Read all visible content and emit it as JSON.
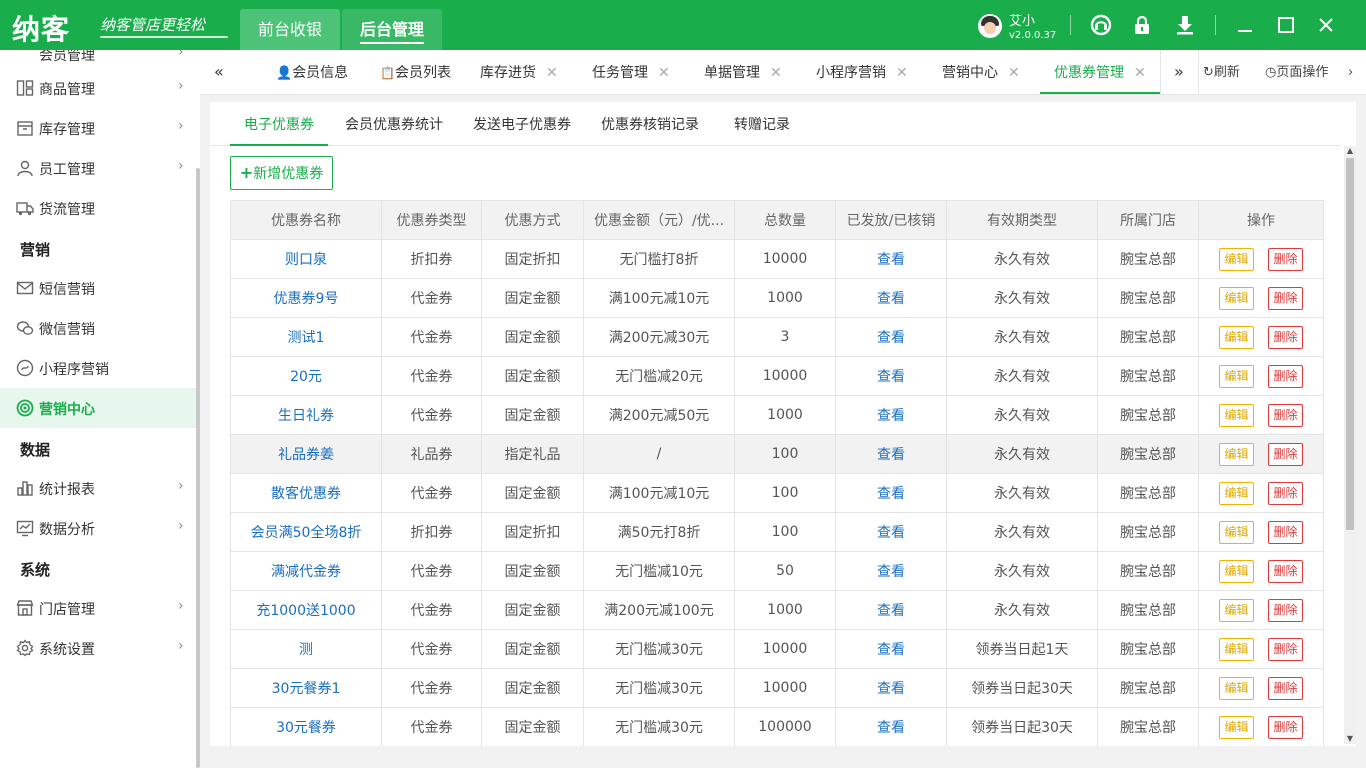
{
  "header": {
    "logo": "纳客",
    "slogan": "纳客管店更轻松",
    "nav": [
      "前台收银",
      "后台管理"
    ],
    "active_nav": 1,
    "user_name": "艾小",
    "version": "v2.0.0.37",
    "icons": [
      "headset-icon",
      "lock-icon",
      "download-icon",
      "minimize-icon",
      "maximize-icon",
      "close-icon"
    ]
  },
  "sidebar": {
    "partial_item": "会员管理",
    "items": [
      {
        "label": "商品管理",
        "icon": "product-icon",
        "arrow": true
      },
      {
        "label": "库存管理",
        "icon": "inventory-icon",
        "arrow": true
      },
      {
        "label": "员工管理",
        "icon": "staff-icon",
        "arrow": true
      },
      {
        "label": "货流管理",
        "icon": "truck-icon",
        "arrow": false
      }
    ],
    "group_marketing": "营销",
    "marketing_items": [
      {
        "label": "短信营销",
        "icon": "sms-icon"
      },
      {
        "label": "微信营销",
        "icon": "wechat-icon"
      },
      {
        "label": "小程序营销",
        "icon": "mini-program-icon"
      },
      {
        "label": "营销中心",
        "icon": "target-icon"
      }
    ],
    "group_data": "数据",
    "data_items": [
      {
        "label": "统计报表",
        "icon": "bar-chart-icon"
      },
      {
        "label": "数据分析",
        "icon": "analytics-icon"
      }
    ],
    "group_system": "系统",
    "system_items": [
      {
        "label": "门店管理",
        "icon": "store-icon"
      },
      {
        "label": "系统设置",
        "icon": "gear-icon"
      }
    ]
  },
  "tabs": {
    "items": [
      "会员信息",
      "会员列表",
      "库存进货",
      "任务管理",
      "单据管理",
      "小程序营销",
      "营销中心",
      "优惠券管理"
    ],
    "active": 7,
    "refresh": "刷新",
    "page_ops": "页面操作"
  },
  "subtabs": [
    "电子优惠券",
    "会员优惠券统计",
    "发送电子优惠券",
    "优惠券核销记录",
    "转赠记录"
  ],
  "add_button": "新增优惠券",
  "table": {
    "headers": [
      "优惠券名称",
      "优惠券类型",
      "优惠方式",
      "优惠金额（元）/优...",
      "总数量",
      "已发放/已核销",
      "有效期类型",
      "所属门店",
      "操作"
    ],
    "view_label": "查看",
    "edit_label": "编辑",
    "delete_label": "删除",
    "rows": [
      [
        "则口泉",
        "折扣券",
        "固定折扣",
        "无门槛打8折",
        "10000",
        "永久有效",
        "腕宝总部"
      ],
      [
        "优惠券9号",
        "代金券",
        "固定金额",
        "满100元减10元",
        "1000",
        "永久有效",
        "腕宝总部"
      ],
      [
        "测试1",
        "代金券",
        "固定金额",
        "满200元减30元",
        "3",
        "永久有效",
        "腕宝总部"
      ],
      [
        "20元",
        "代金券",
        "固定金额",
        "无门槛减20元",
        "10000",
        "永久有效",
        "腕宝总部"
      ],
      [
        "生日礼券",
        "代金券",
        "固定金额",
        "满200元减50元",
        "1000",
        "永久有效",
        "腕宝总部"
      ],
      [
        "礼品券姜",
        "礼品券",
        "指定礼品",
        "/",
        "100",
        "永久有效",
        "腕宝总部"
      ],
      [
        "散客优惠券",
        "代金券",
        "固定金额",
        "满100元减10元",
        "100",
        "永久有效",
        "腕宝总部"
      ],
      [
        "会员满50全场8折",
        "折扣券",
        "固定折扣",
        "满50元打8折",
        "100",
        "永久有效",
        "腕宝总部"
      ],
      [
        "满减代金券",
        "代金券",
        "固定金额",
        "无门槛减10元",
        "50",
        "永久有效",
        "腕宝总部"
      ],
      [
        "充1000送1000",
        "代金券",
        "固定金额",
        "满200元减100元",
        "1000",
        "永久有效",
        "腕宝总部"
      ],
      [
        "测",
        "代金券",
        "固定金额",
        "无门槛减30元",
        "10000",
        "领券当日起1天",
        "腕宝总部"
      ],
      [
        "30元餐券1",
        "代金券",
        "固定金额",
        "无门槛减30元",
        "10000",
        "领券当日起30天",
        "腕宝总部"
      ],
      [
        "30元餐券",
        "代金券",
        "固定金额",
        "无门槛减30元",
        "100000",
        "领券当日起30天",
        "腕宝总部"
      ]
    ],
    "highlighted_row": 5
  }
}
